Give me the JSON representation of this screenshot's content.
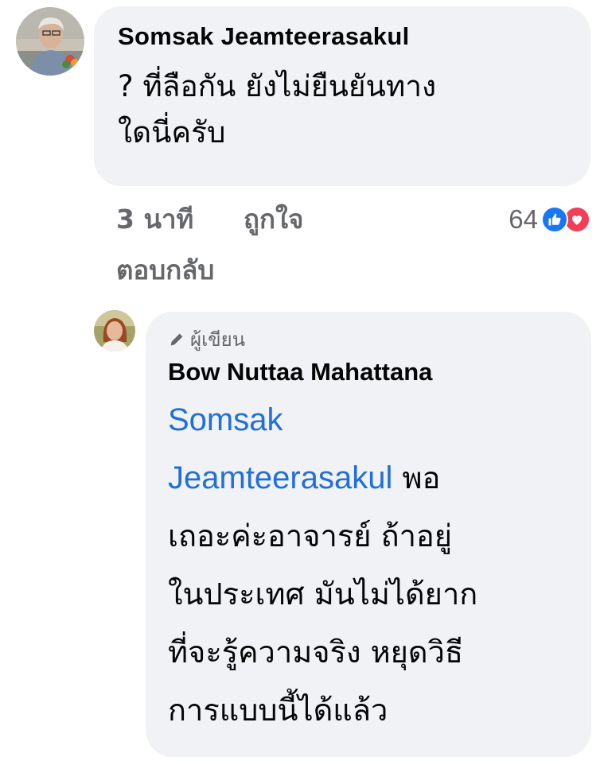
{
  "comments": [
    {
      "author": "Somsak Jeamteerasakul",
      "text_lines": [
        "? ที่ลือกัน ยังไม่ยืนยันทาง",
        "ใดนี่ครับ"
      ],
      "time": "3 นาที",
      "like_label": "ถูกใจ",
      "reply_label": "ตอบกลับ",
      "reaction_count": "64",
      "reactions": [
        "like-icon",
        "love-icon"
      ]
    },
    {
      "badge": "ผู้เขียน",
      "badge_icon": "pencil-icon",
      "author": "Bow Nuttaa Mahattana",
      "mention_line1": "Somsak",
      "mention_line2": "Jeamteerasakul",
      "text_after_mention": " พอ",
      "text_lines": [
        "เถอะค่ะอาจารย์ ถ้าอยู่",
        "ในประเทศ มันไม่ได้ยาก",
        "ที่จะรู้ความจริง หยุดวิธี",
        "การแบบนี้ได้แล้ว"
      ]
    }
  ],
  "colors": {
    "bubble": "#f0f2f5",
    "mention": "#216fdb",
    "secondary_text": "#65676b",
    "like": "#1877f2",
    "love": "#f33e58"
  }
}
